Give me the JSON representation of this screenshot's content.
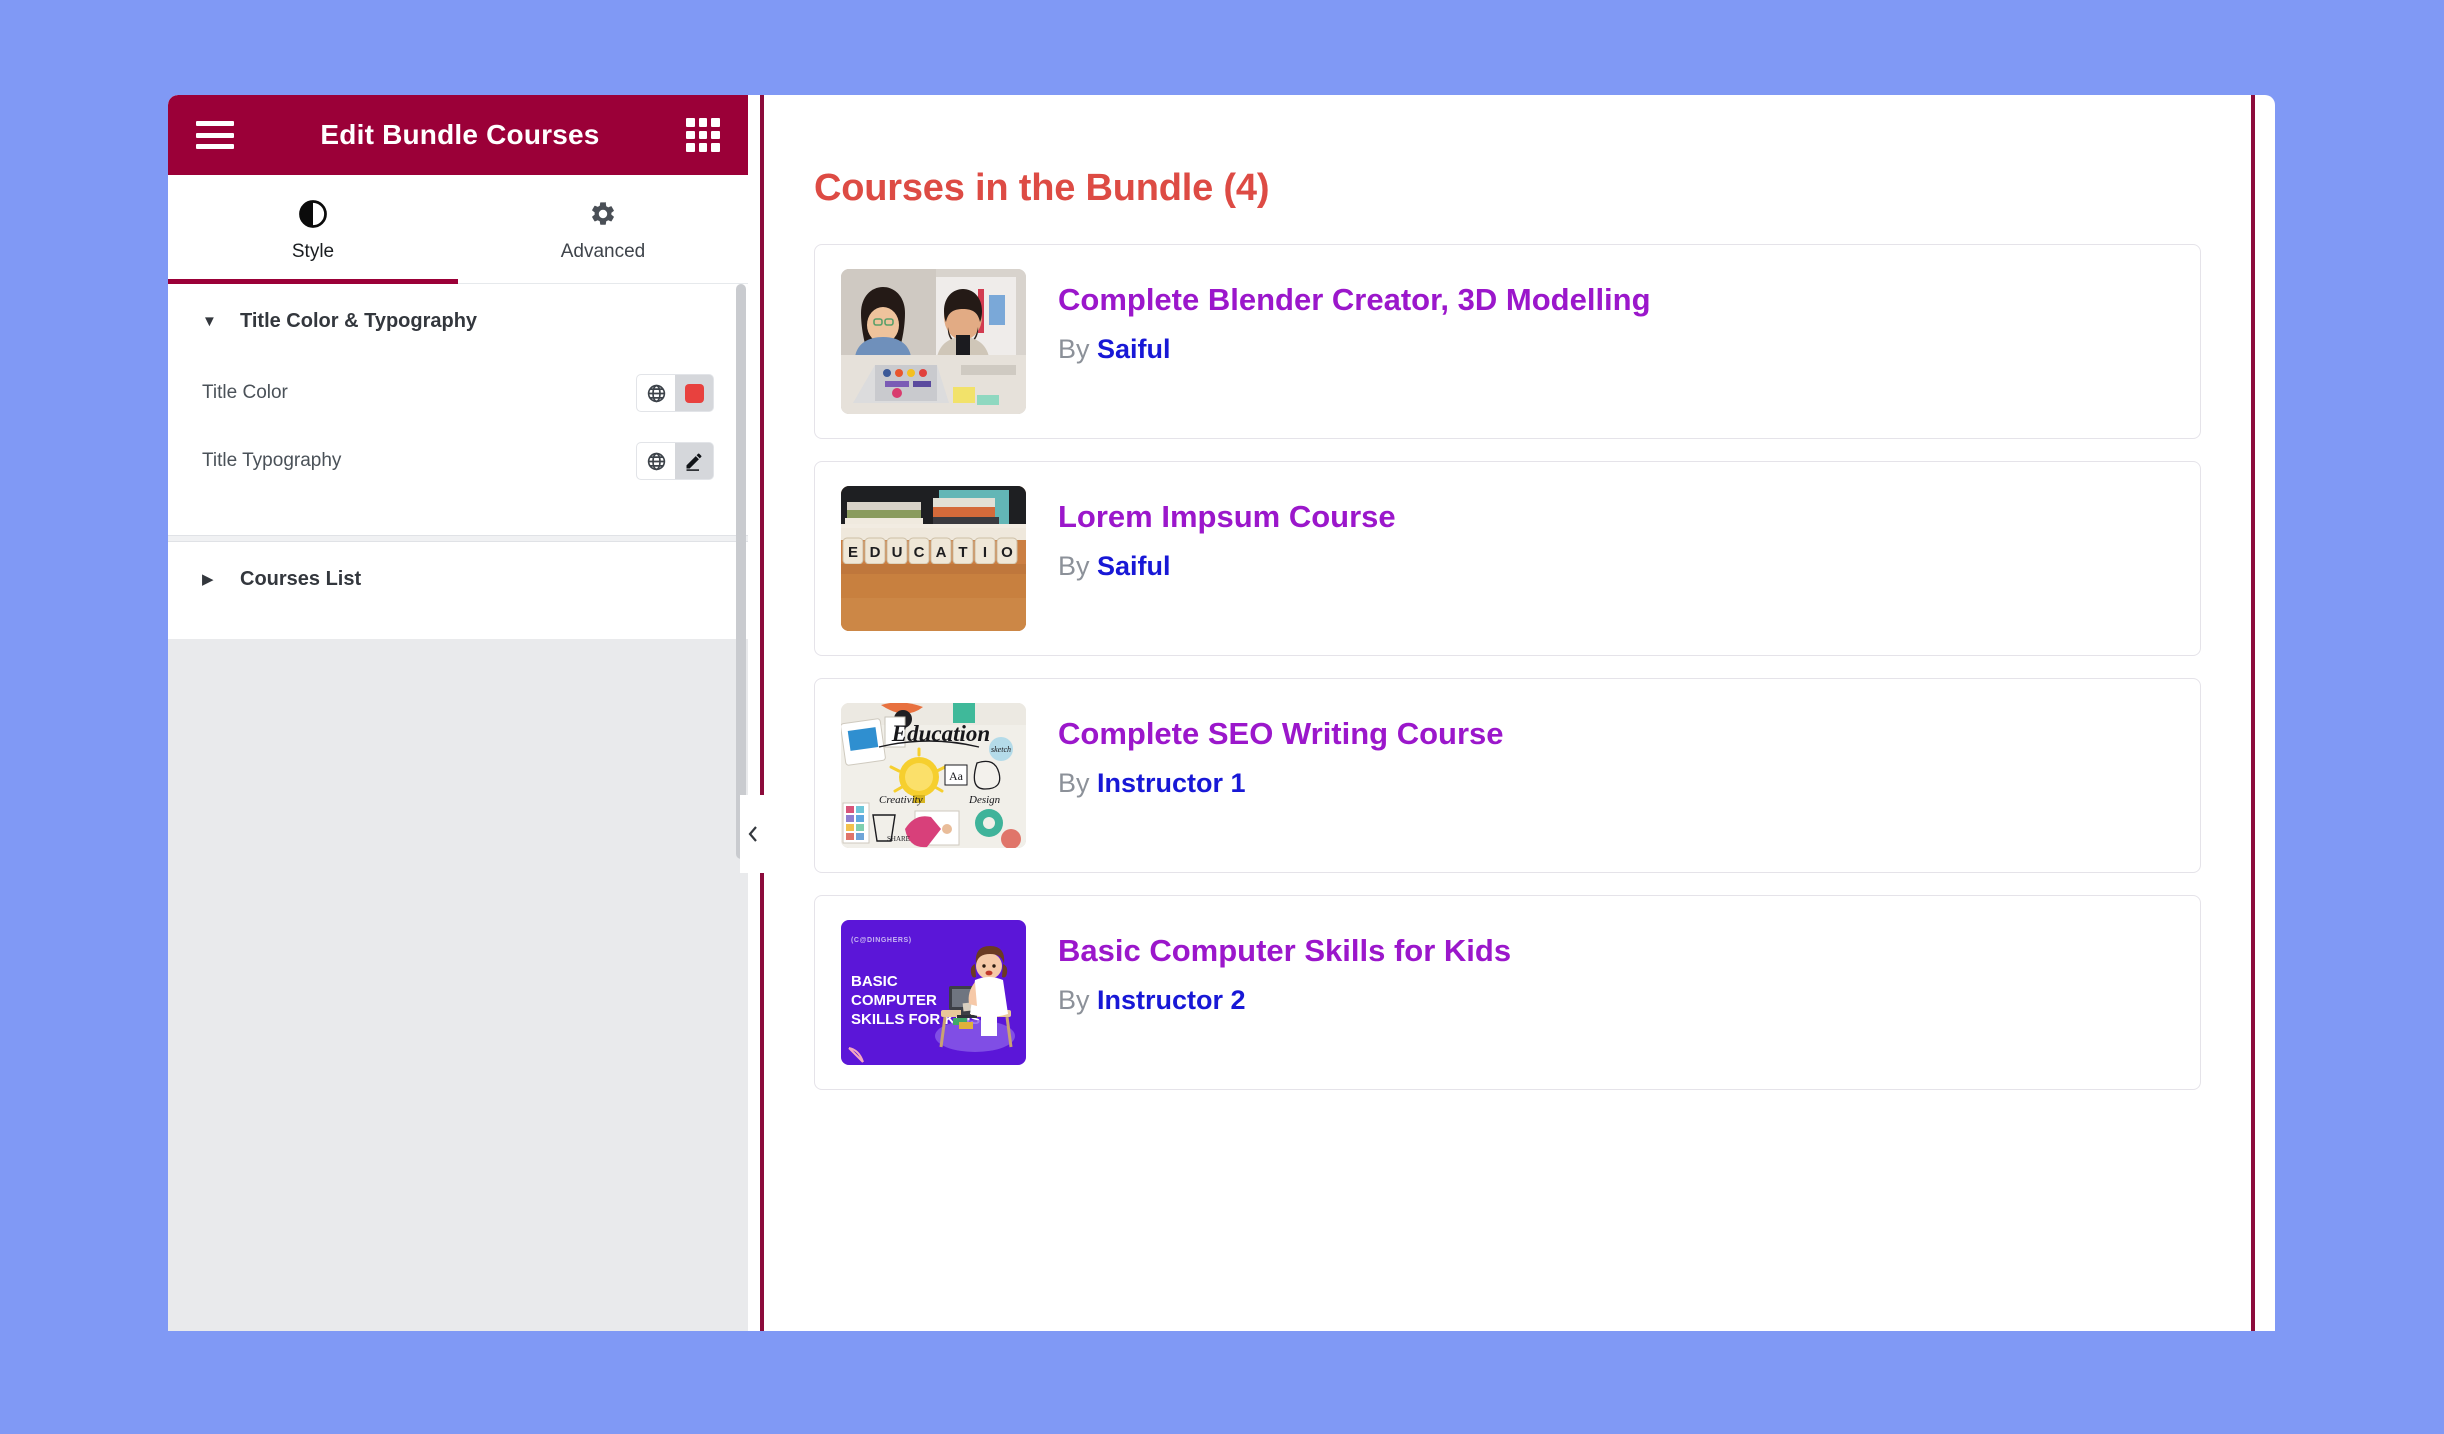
{
  "theme": {
    "page_background": "#8099f5",
    "header_background": "#9b0038",
    "frame_border": "#8c0b3b",
    "heading_color": "#dd4b44",
    "course_title_color": "#9b17cb",
    "author_color": "#1818d6",
    "title_color_swatch": "#e8413e"
  },
  "panel": {
    "header": {
      "title": "Edit Bundle Courses",
      "menu_icon": "hamburger-icon",
      "apps_icon": "grid-icon"
    },
    "tabs": [
      {
        "label": "Style",
        "icon": "contrast-icon",
        "active": true
      },
      {
        "label": "Advanced",
        "icon": "gear-icon",
        "active": false
      }
    ],
    "sections": [
      {
        "title": "Title Color & Typography",
        "expanded": true,
        "caret": "▼",
        "controls": [
          {
            "label": "Title Color",
            "globe_icon": "globe-icon",
            "value_icon": "color-swatch",
            "value_color": "#e8413e"
          },
          {
            "label": "Title Typography",
            "globe_icon": "globe-icon",
            "value_icon": "pencil-icon"
          }
        ]
      },
      {
        "title": "Courses List",
        "expanded": false,
        "caret": "▶",
        "controls": []
      }
    ]
  },
  "preview": {
    "scrolled_remnant_text": "",
    "bundle_heading": "Courses in the Bundle (4)",
    "by_prefix": "By",
    "collapse_handle_icon": "chevron-left-icon",
    "courses": [
      {
        "title": "Complete Blender Creator, 3D Modelling",
        "author": "Saiful",
        "thumb": "two-people-laptop-photo"
      },
      {
        "title": "Lorem Impsum Course",
        "author": "Saiful",
        "thumb": "education-blocks-photo"
      },
      {
        "title": "Complete SEO Writing Course",
        "author": "Instructor 1",
        "thumb": "education-doodle-photo"
      },
      {
        "title": "Basic Computer Skills for Kids",
        "author": "Instructor 2",
        "thumb": "basic-computer-skills-kids-graphic"
      }
    ]
  }
}
